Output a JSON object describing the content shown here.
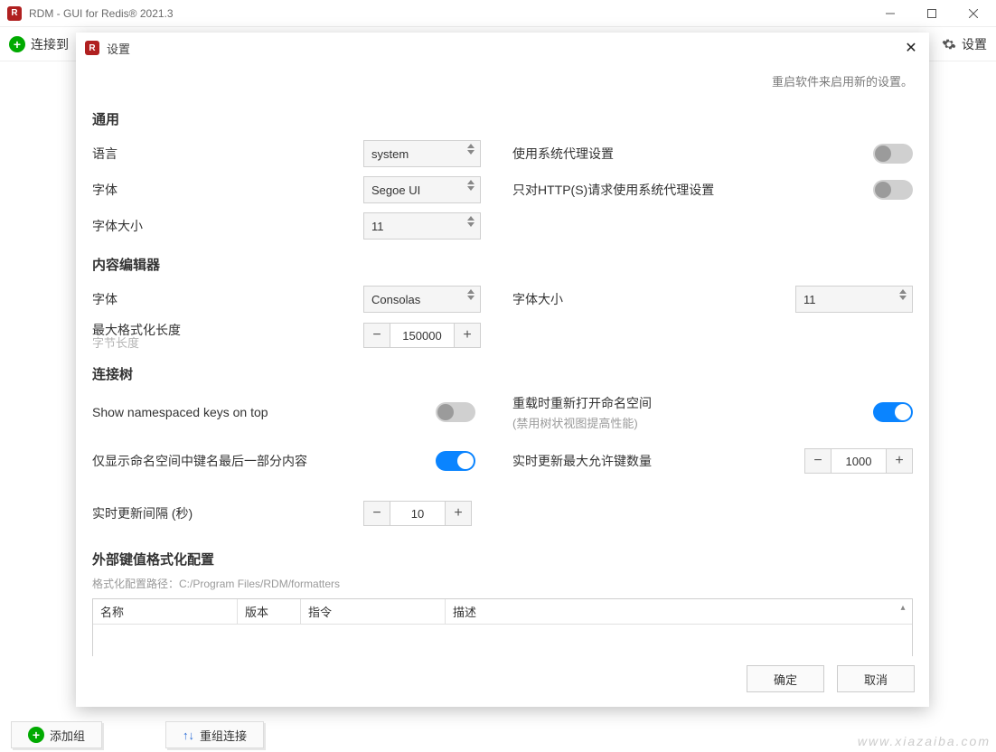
{
  "window": {
    "title": "RDM - GUI for Redis® 2021.3"
  },
  "toolbar": {
    "connect_label": "连接到",
    "settings_label": "设置"
  },
  "modal": {
    "title": "设置",
    "hint": "重启软件来启用新的设置。"
  },
  "general": {
    "section": "通用",
    "language_label": "语言",
    "language_value": "system",
    "font_label": "字体",
    "font_value": "Segoe UI",
    "fontsize_label": "字体大小",
    "fontsize_value": "11",
    "use_proxy_label": "使用系统代理设置",
    "http_proxy_label": "只对HTTP(S)请求使用系统代理设置"
  },
  "editor": {
    "section": "内容编辑器",
    "font_label": "字体",
    "font_value": "Consolas",
    "fontsize_label": "字体大小",
    "fontsize_value": "11",
    "maxlen_label": "最大格式化长度",
    "maxlen_sub": "字节长度",
    "maxlen_value": "150000"
  },
  "tree": {
    "section": "连接树",
    "ns_top_label": "Show namespaced keys on top",
    "reopen_label": "重载时重新打开命名空间",
    "reopen_sub": "(禁用树状视图提高性能)",
    "lastpart_label": "仅显示命名空间中键名最后一部分内容",
    "max_keys_label": "实时更新最大允许键数量",
    "max_keys_value": "1000",
    "interval_label": "实时更新间隔 (秒)",
    "interval_value": "10"
  },
  "formatters": {
    "section": "外部键值格式化配置",
    "path_prefix": "格式化配置路径：",
    "path_value": "C:/Program Files/RDM/formatters",
    "cols": {
      "name": "名称",
      "version": "版本",
      "command": "指令",
      "desc": "描述"
    }
  },
  "buttons": {
    "ok": "确定",
    "cancel": "取消",
    "add_group": "添加组",
    "reorder": "重组连接"
  },
  "watermark": "www.xiazaiba.com"
}
